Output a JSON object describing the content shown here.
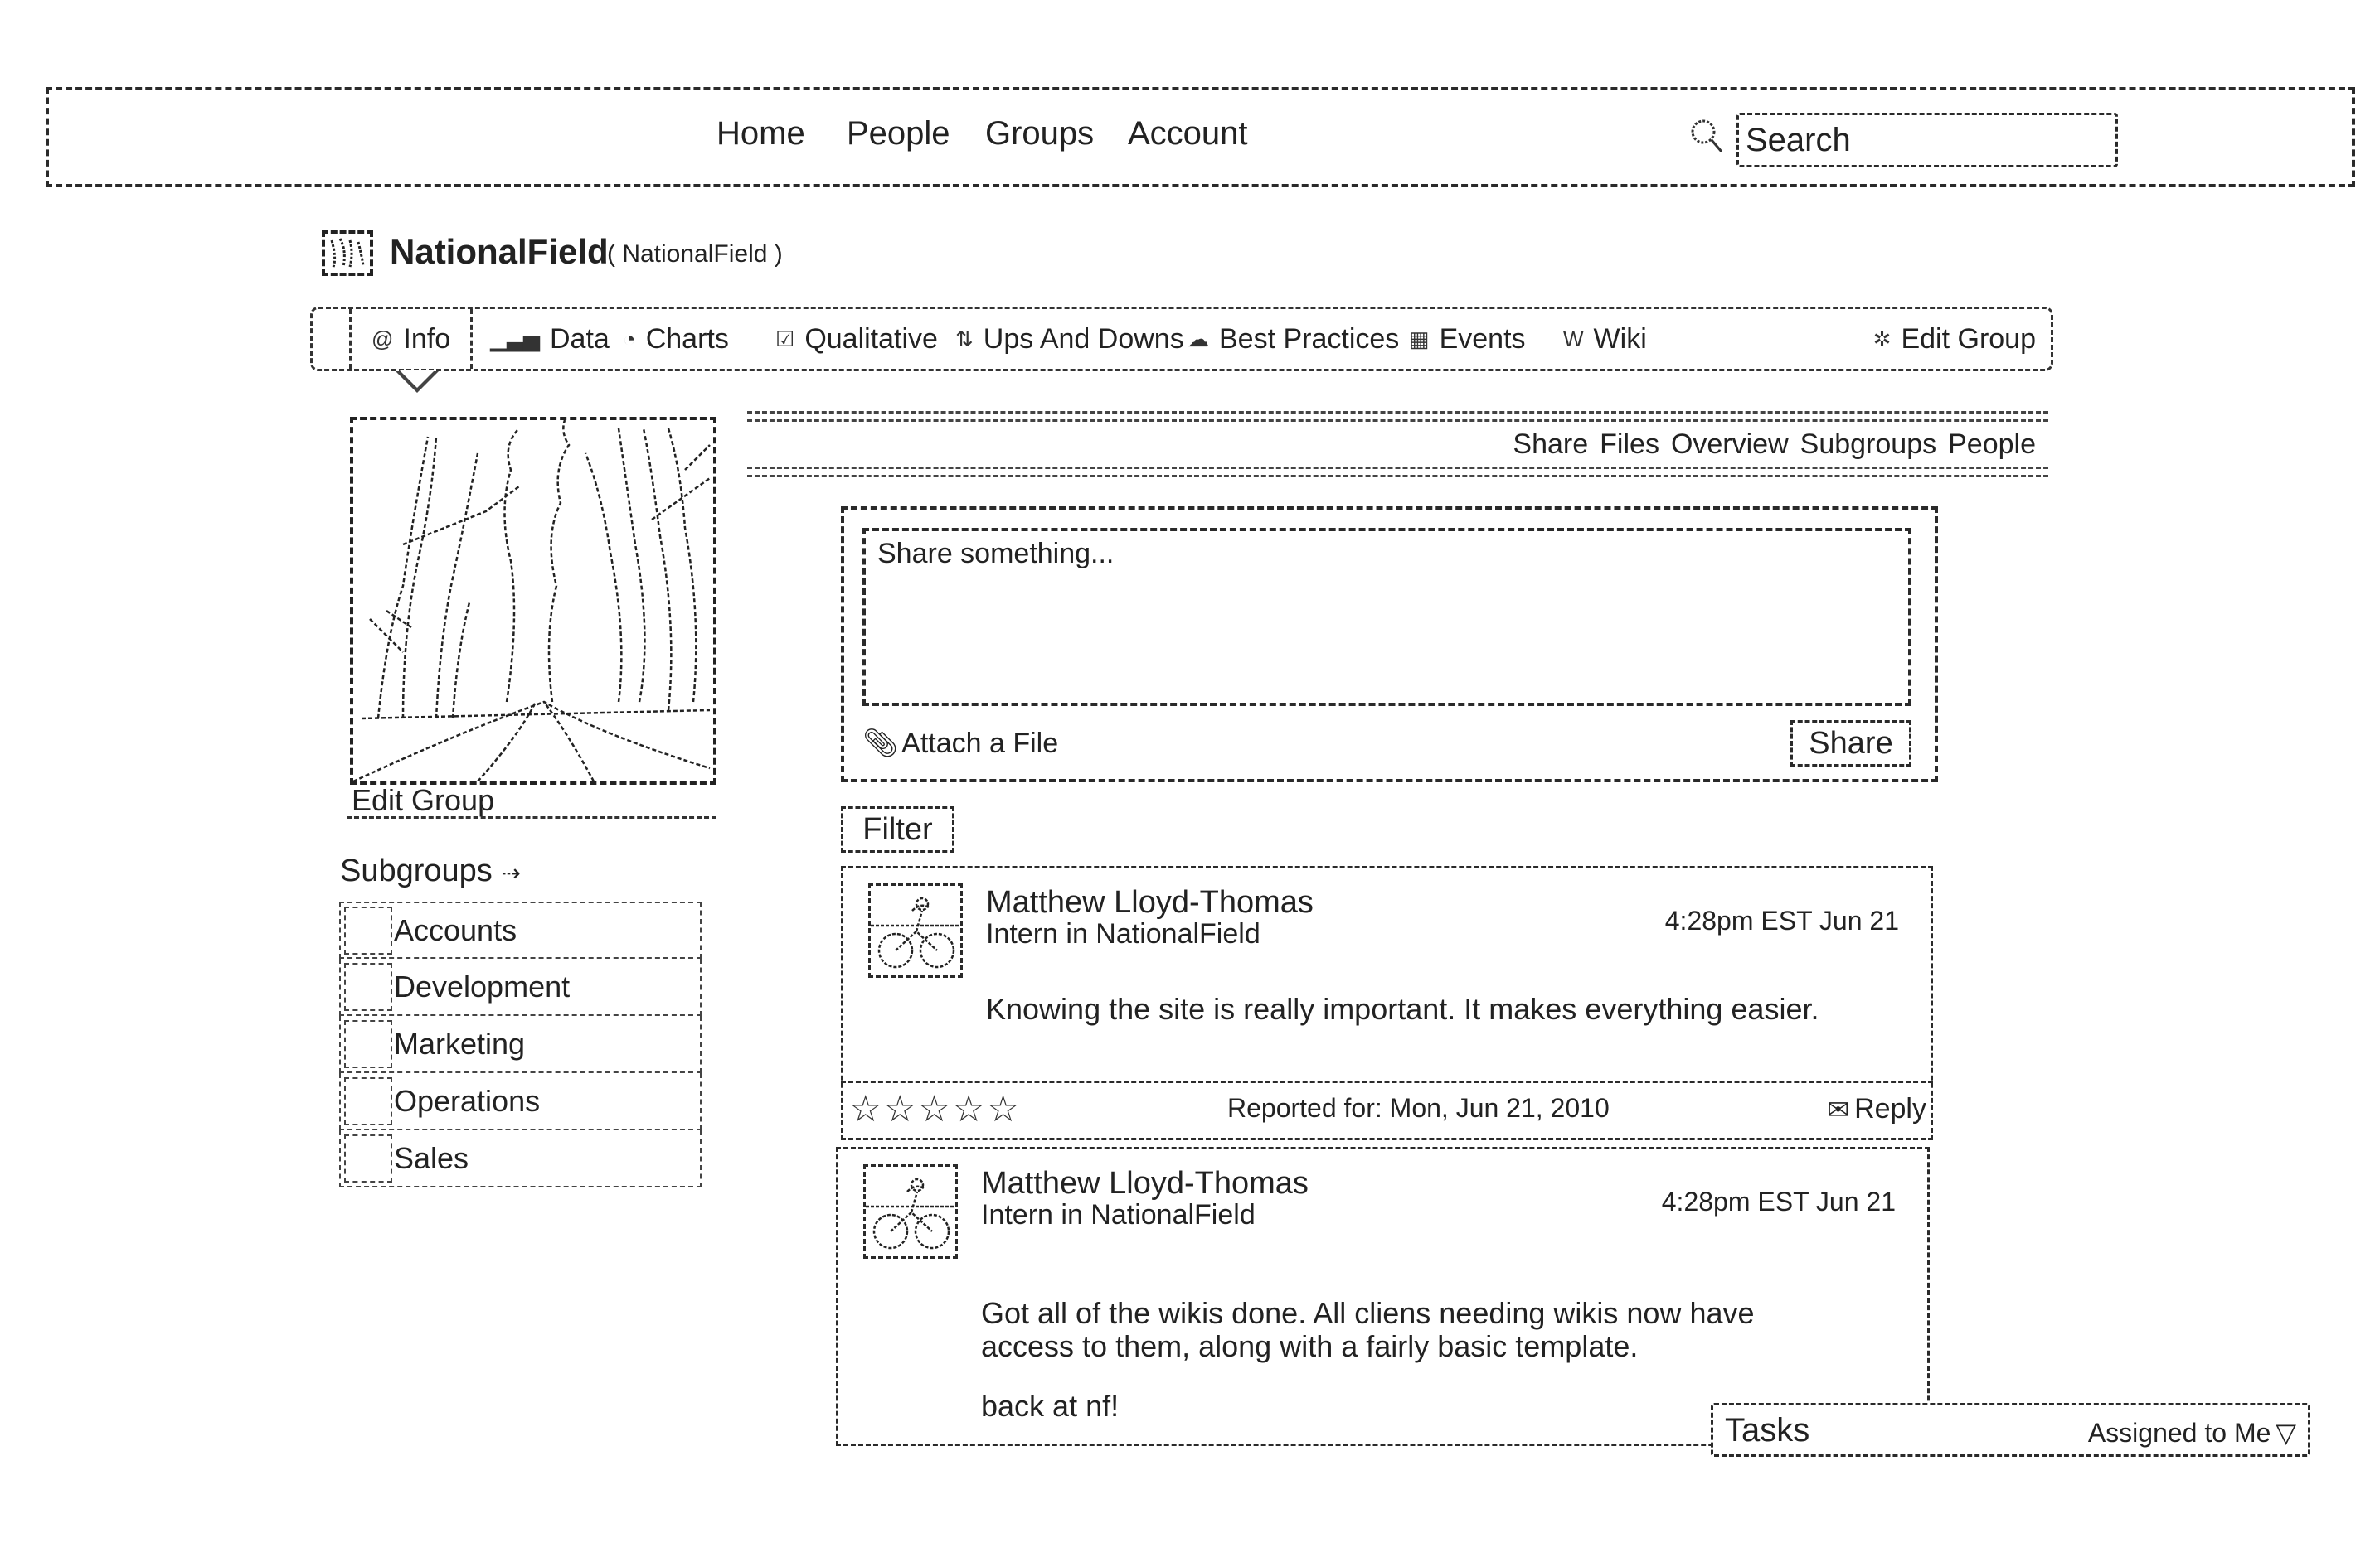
{
  "topnav": {
    "links": [
      "Home",
      "People",
      "Groups",
      "Account"
    ],
    "search": {
      "placeholder": "Search",
      "icon": "search-icon"
    }
  },
  "group": {
    "name": "NationalField",
    "handle": "( NationalField )"
  },
  "tabs": [
    {
      "label": "Info",
      "icon": "at-icon",
      "active": true
    },
    {
      "label": "Data",
      "icon": "bar-chart-icon"
    },
    {
      "label": "Charts",
      "icon": "pie-chart-icon"
    },
    {
      "label": "Qualitative",
      "icon": "checkbox-icon"
    },
    {
      "label": "Ups And Downs",
      "icon": "updown-icon"
    },
    {
      "label": "Best Practices",
      "icon": "cloud-icon"
    },
    {
      "label": "Events",
      "icon": "calendar-icon"
    },
    {
      "label": "Wiki",
      "icon": "wiki-icon"
    }
  ],
  "edit_group_tab": {
    "label": "Edit Group",
    "icon": "gear-icon"
  },
  "sidebar": {
    "edit_group_link": "Edit Group",
    "subgroups_label": "Subgroups",
    "subgroups": [
      "Accounts",
      "Development",
      "Marketing",
      "Operations",
      "Sales"
    ]
  },
  "subnav": [
    "Share",
    "Files",
    "Overview",
    "Subgroups",
    "People"
  ],
  "share": {
    "placeholder": "Share something...",
    "attach_label": "Attach a File",
    "button_label": "Share"
  },
  "filter_label": "Filter",
  "posts": [
    {
      "author": "Matthew Lloyd-Thomas",
      "role": "Intern in NationalField",
      "timestamp": "4:28pm EST Jun 21",
      "body": "Knowing the site is really important. It makes everything easier.",
      "rating": 0,
      "rating_max": 5,
      "reported_for": "Reported for: Mon, Jun 21, 2010",
      "reply_label": "Reply"
    },
    {
      "author": "Matthew Lloyd-Thomas",
      "role": "Intern in NationalField",
      "timestamp": "4:28pm EST Jun 21",
      "body": "Got all of the wikis done. All cliens needing wikis now have access to them, along with a fairly basic template.",
      "body2": "back at nf!"
    }
  ],
  "tasks": {
    "title": "Tasks",
    "filter": "Assigned to Me"
  }
}
